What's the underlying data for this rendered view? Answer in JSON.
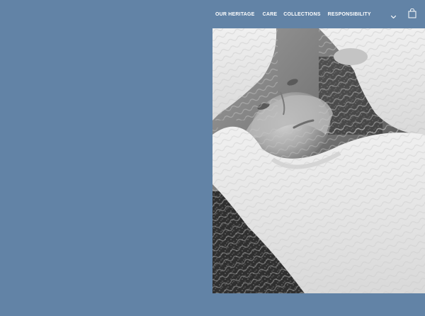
{
  "page": {
    "background_color": "#6283a6"
  },
  "nav": {
    "items": [
      {
        "label": "OUR HERITAGE"
      },
      {
        "label": "CARE"
      },
      {
        "label": "COLLECTIONS"
      },
      {
        "label": "RESPONSIBILITY"
      }
    ],
    "text_color": "#ffffff",
    "dropdown_icon": "chevron-down-icon",
    "cart_icon": "shopping-bag-icon"
  },
  "hero": {
    "image_style": "black-and-white"
  }
}
